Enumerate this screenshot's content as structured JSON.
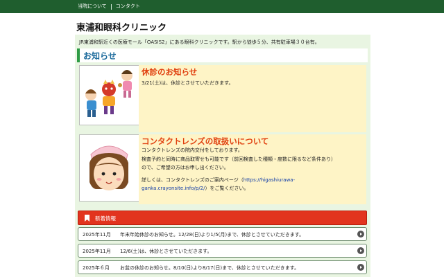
{
  "nav": {
    "items": [
      "当院について",
      "コンタクト"
    ]
  },
  "site": {
    "title": "東浦和眼科クリニック"
  },
  "intro": "JR東浦和駅近くの医療モール「OASIS2」にある眼科クリニックです。駅から徒歩５分、共有駐車場３０台有。",
  "section": {
    "heading": "お知らせ"
  },
  "notices": [
    {
      "title": "休診のお知らせ",
      "lines": [
        "3/21(土)は、休診とさせていただきます。"
      ]
    },
    {
      "title": "コンタクトレンズの取扱いについて",
      "lines": [
        "コンタクトレンズの院内交付をしております。",
        "検査予約と同時に商品取寄せも可能です（前回検査した種類・度数に限るなど条件あり）",
        "ので、ご希望の方はお申し出ください。"
      ],
      "link_pre": "詳しくは、コンタクトレンズのご案内ページ（",
      "link_text": "https://higashiurawa-",
      "link_text2": "ganka.crayonsite.info/p/2/",
      "link_post": "）をご覧ください。"
    }
  ],
  "news": {
    "heading": "新着情報",
    "items": [
      {
        "date": "2025年11月",
        "text": "年末年始休診のお知らせ。12/28(日)より1/5(月)まで、休診とさせていただきます。"
      },
      {
        "date": "2025年11月",
        "text": "12/6(土)は、休診とさせていただきます。"
      },
      {
        "date": "2025年６月",
        "text": "お盆の休診のお知らせ。8/10(日)より8/17(日)まで、休診とさせていただきます。"
      }
    ]
  },
  "colors": {
    "topbar": "#1f5e2e",
    "content_bg": "#e9f5e2",
    "notice_bg": "#fef4c6",
    "notice_title": "#e0400f",
    "news_head": "#e2341e",
    "link": "#0e3aa8"
  }
}
